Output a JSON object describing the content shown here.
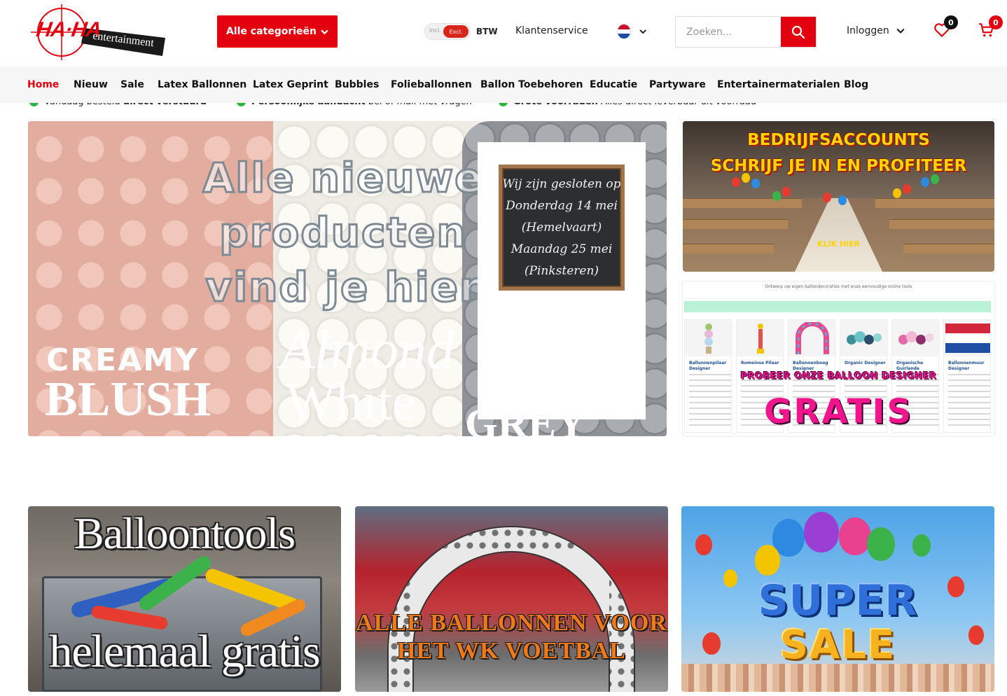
{
  "header": {
    "logo_text_main": "HA·HA",
    "logo_text_sub": "entertainment",
    "category_button": "Alle categorieën",
    "tax_toggle": {
      "incl": "Incl.",
      "excl": "Excl.",
      "label": "BTW"
    },
    "customer_service": "Klantenservice",
    "language": "NL",
    "search": {
      "placeholder": "Zoeken..."
    },
    "login": "Inloggen",
    "wishlist_count": "0",
    "cart_count": "0"
  },
  "nav": {
    "items": [
      {
        "label": "Home",
        "active": true
      },
      {
        "label": "Nieuw"
      },
      {
        "label": "Sale"
      },
      {
        "label": "Latex Ballonnen"
      },
      {
        "label": "Latex Geprint"
      },
      {
        "label": "Bubbles"
      },
      {
        "label": "Folieballonnen"
      },
      {
        "label": "Ballon Toebehoren"
      },
      {
        "label": "Educatie"
      },
      {
        "label": "Partyware"
      },
      {
        "label": "Entertainermaterialen"
      },
      {
        "label": "Blog"
      }
    ]
  },
  "usps": [
    {
      "bold": "",
      "text": "Vandaag besteld ",
      "strong": "direct verstuurd"
    },
    {
      "bold": "Persoonlijke aandacht",
      "text": " bel of mail met vragen"
    },
    {
      "bold": "Grote voorraden",
      "text": " Alles direct leverbaar uit voorraad"
    }
  ],
  "hero": {
    "headline": [
      "Alle nieuwe",
      "producten",
      "vind je hier"
    ],
    "creamy": "CREAMY",
    "blush": "BLUSH",
    "almond": "Almond",
    "white": "White",
    "grey": "GREY",
    "notice": [
      "Wij zijn gesloten op",
      "Donderdag 14 mei",
      "(Hemelvaart)",
      "Maandag 25 mei",
      "(Pinksteren)"
    ]
  },
  "promo_business": {
    "line1": "BEDRIJFSACCOUNTS",
    "line2": "SCHRIJF JE IN EN PROFITEER",
    "cta": "KLIK HIER"
  },
  "promo_designer": {
    "title": "Ontwerp uw eigen ballondecoraties met onze eenvoudige online tools",
    "tools": [
      "Ballonnenpilaar Designer",
      "Romeinse Pilaar",
      "Ballonnenboog Designer",
      "Organic Designer",
      "Organische Guirlande",
      "Ballonnenmuur Designer"
    ],
    "headline": "PROBEER ONZE BALLOON DESIGNER",
    "badge": "GRATIS"
  },
  "cards": [
    {
      "line1": "Balloontools",
      "line2": "helemaal gratis"
    },
    {
      "line1": "ALLE BALLONNEN VOOR",
      "line2": "HET WK VOETBAL"
    },
    {
      "line1": "SUPER",
      "line2": "SALE"
    }
  ],
  "colors": {
    "brand_red": "#e3000f",
    "usp_green": "#2db342",
    "active_nav": "#e3000f"
  },
  "icons": [
    "chevron-down-icon",
    "search-icon",
    "heart-icon",
    "cart-icon",
    "netherlands-flag-icon",
    "check-dot-icon"
  ]
}
